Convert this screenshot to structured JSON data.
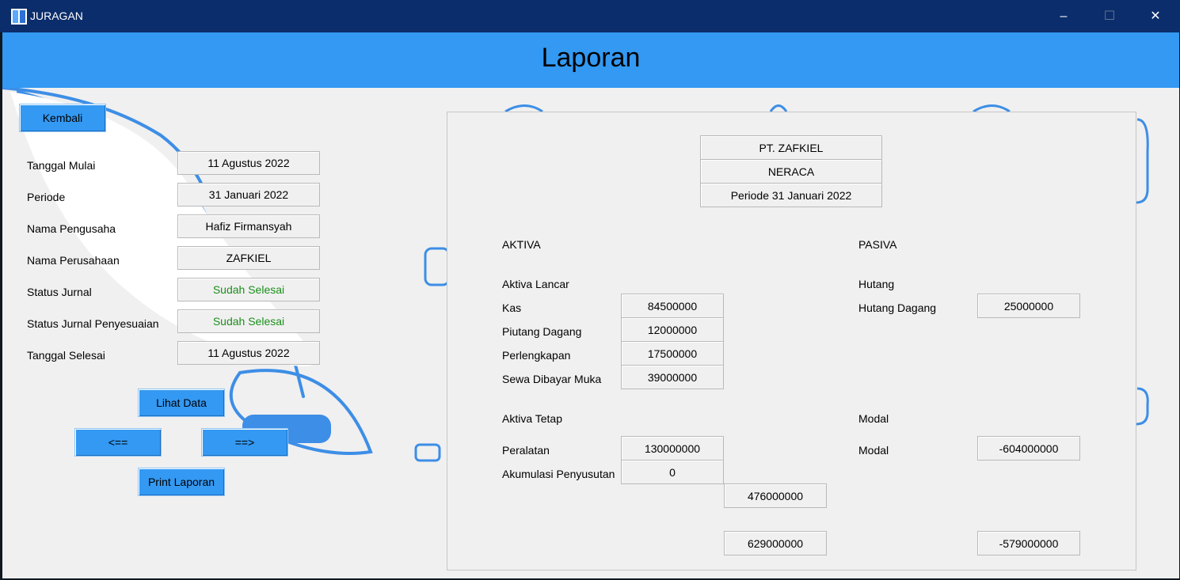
{
  "window": {
    "title": "JURAGAN",
    "controls": {
      "minimize": "–",
      "maximize": "☐",
      "close": "✕"
    }
  },
  "header": {
    "title": "Laporan"
  },
  "left": {
    "back_label": "Kembali",
    "fields": [
      {
        "label": "Tanggal Mulai",
        "value": "11 Agustus 2022"
      },
      {
        "label": "Periode",
        "value": "31 Januari 2022"
      },
      {
        "label": "Nama Pengusaha",
        "value": "Hafiz Firmansyah"
      },
      {
        "label": "Nama Perusahaan",
        "value": "ZAFKIEL"
      },
      {
        "label": "Status Jurnal",
        "value": "Sudah Selesai"
      },
      {
        "label": "Status Jurnal Penyesuaian",
        "value": "Sudah Selesai"
      },
      {
        "label": "Tanggal Selesai",
        "value": "11 Agustus 2022"
      }
    ],
    "lihat_data": "Lihat Data",
    "prev": "<==",
    "next": "==>",
    "print": "Print Laporan"
  },
  "report": {
    "company": "PT. ZAFKIEL",
    "statement": "NERACA",
    "period": "Periode 31 Januari 2022",
    "aktiva": {
      "heading": "AKTIVA",
      "lancar_heading": "Aktiva Lancar",
      "lancar": [
        {
          "label": "Kas",
          "value": "84500000"
        },
        {
          "label": "Piutang Dagang",
          "value": "12000000"
        },
        {
          "label": "Perlengkapan",
          "value": "17500000"
        },
        {
          "label": "Sewa Dibayar Muka",
          "value": "39000000"
        }
      ],
      "tetap_heading": "Aktiva Tetap",
      "tetap": [
        {
          "label": "Peralatan",
          "value": "130000000"
        },
        {
          "label": "Akumulasi Penyusutan",
          "value": "0"
        }
      ],
      "subtotal": "476000000",
      "total": "629000000"
    },
    "pasiva": {
      "heading": "PASIVA",
      "hutang_heading": "Hutang",
      "hutang": [
        {
          "label": "Hutang Dagang",
          "value": "25000000"
        }
      ],
      "modal_heading": "Modal",
      "modal": [
        {
          "label": "Modal",
          "value": "-604000000"
        }
      ],
      "total": "-579000000"
    }
  },
  "colors": {
    "accent": "#3399f3",
    "titlebar": "#0b2d6b",
    "status_ok": "#1a8f1a"
  }
}
